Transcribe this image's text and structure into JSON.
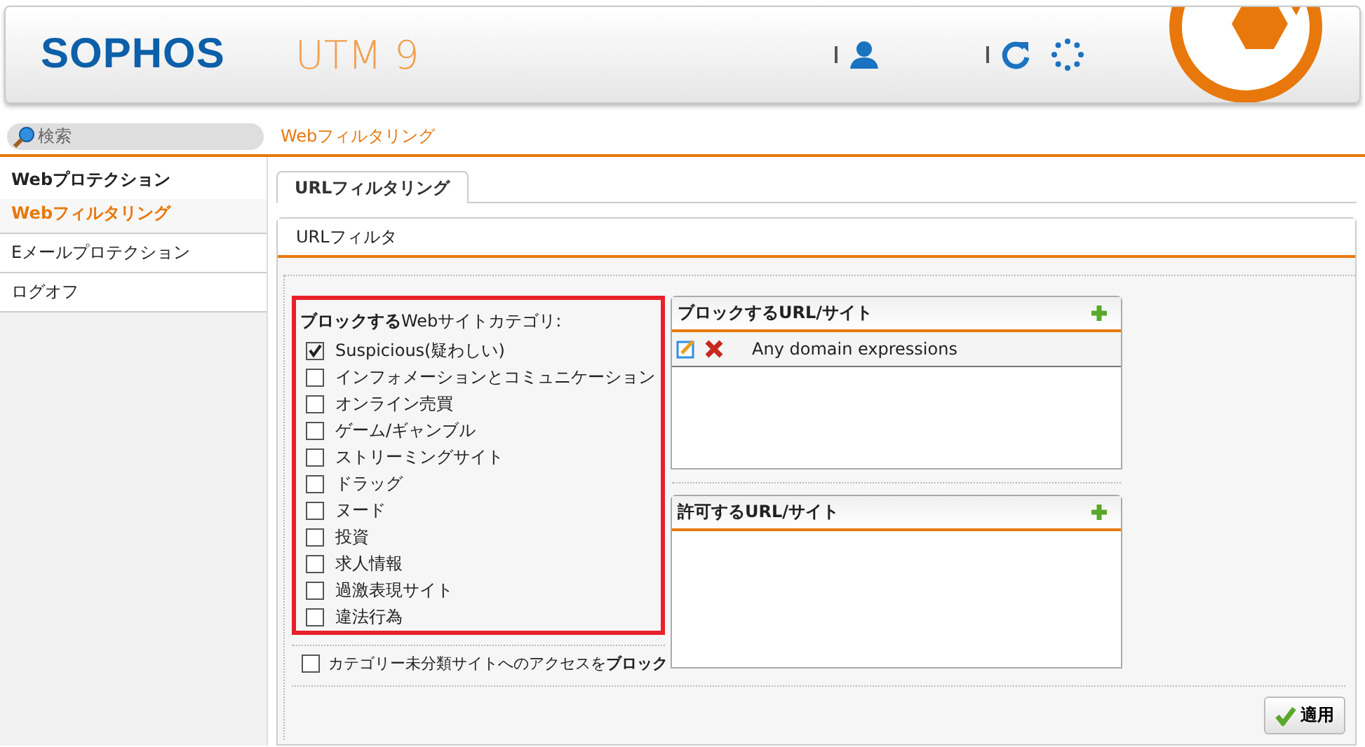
{
  "header": {
    "logo": "SOPHOS",
    "product": "UTM 9"
  },
  "search": {
    "placeholder": "検索"
  },
  "breadcrumb": "Webフィルタリング",
  "sidebar": {
    "items": [
      {
        "label": "Webプロテクション",
        "selected": false,
        "children": [
          {
            "label": "Webフィルタリング",
            "selected": true
          }
        ]
      },
      {
        "label": "Eメールプロテクション",
        "selected": false
      },
      {
        "label": "ログオフ",
        "selected": false
      }
    ]
  },
  "tabs": [
    {
      "label": "URLフィルタリング",
      "selected": true
    }
  ],
  "panel_title": "URLフィルタ",
  "categories": {
    "label": "**ブロックする**Webサイトカテゴリ:",
    "items": [
      {
        "label": "Suspicious(疑わしい)",
        "checked": true
      },
      {
        "label": "インフォメーションとコミュニケーション",
        "checked": false
      },
      {
        "label": "オンライン売買",
        "checked": false
      },
      {
        "label": "ゲーム/ギャンブル",
        "checked": false
      },
      {
        "label": "ストリーミングサイト",
        "checked": false
      },
      {
        "label": "ドラッグ",
        "checked": false
      },
      {
        "label": "ヌード",
        "checked": false
      },
      {
        "label": "投資",
        "checked": false
      },
      {
        "label": "求人情報",
        "checked": false
      },
      {
        "label": "過激表現サイト",
        "checked": false
      },
      {
        "label": "違法行為",
        "checked": false
      }
    ]
  },
  "unclassified": {
    "label": "カテゴリー未分類サイトへのアクセスを**ブロック**",
    "checked": false
  },
  "url_lists": [
    {
      "title": "ブロックするURL/サイト",
      "entries": [
        "Any domain expressions"
      ]
    },
    {
      "title": "許可するURL/サイト"
    }
  ],
  "apply_button": "適用"
}
